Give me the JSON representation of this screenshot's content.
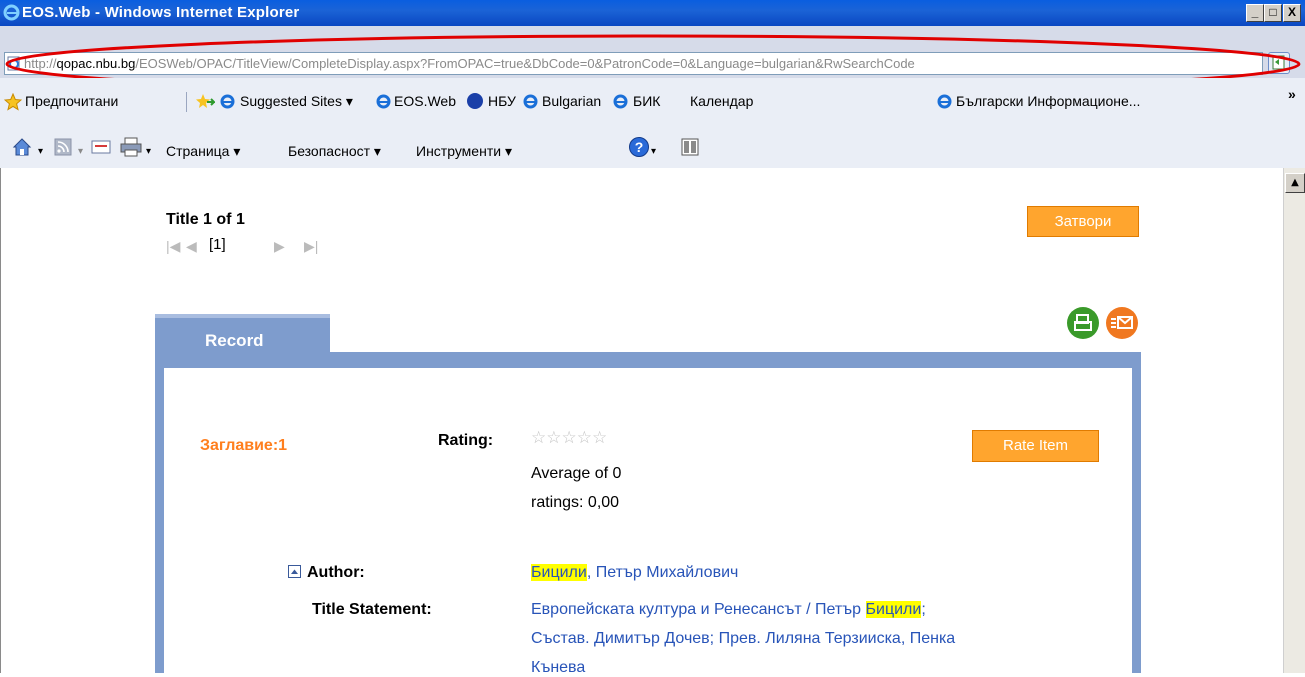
{
  "window": {
    "title": "EOS.Web - Windows Internet Explorer",
    "minimize": "_",
    "maximize": "□",
    "close": "X"
  },
  "address": {
    "url_prefix": "http://",
    "url_host": "qopac.nbu.bg",
    "url_rest": "/EOSWeb/OPAC/TitleView/CompleteDisplay.aspx?FromOPAC=true&DbCode=0&PatronCode=0&Language=bulgarian&RwSearchCode"
  },
  "favorites": {
    "favorites_label": "Предпочитани",
    "items": [
      "Suggested Sites ▾",
      "EOS.Web",
      "НБУ",
      "Bulgarian",
      "БИК",
      "Календар",
      "Български Информационе..."
    ],
    "overflow": "»"
  },
  "commandbar": {
    "page": "Страница ▾",
    "safety": "Безопасност ▾",
    "tools": "Инструменти ▾",
    "help": "▾"
  },
  "content": {
    "title_count": "Title 1 of 1",
    "pager": {
      "first": "|◀",
      "prev": "◀",
      "current": "[1]",
      "next": "▶",
      "last": "▶|"
    },
    "close_button": "Затвори",
    "tab_label": "Record",
    "record": {
      "zaglavie_label": "Заглавие:1",
      "rating_label": "Rating:",
      "stars": "☆☆☆☆☆",
      "average_line1": "Average of 0",
      "average_line2": "ratings: 0,00",
      "rate_button": "Rate Item",
      "author_label": "Author:",
      "author_highlight": "Бицили",
      "author_rest": ", Петър Михайлович",
      "title_statement_label": "Title Statement:",
      "title_line1_pre": "Европейската култура и Ренесансът / Петър ",
      "title_line1_hl": "Бицили",
      "title_line1_post": ";",
      "title_line2": "Състав. Димитър Дочев; Прев. Лиляна Терзииска, Пенка",
      "title_line3": "Кънева"
    }
  },
  "colors": {
    "accent_orange": "#ffa52e",
    "tab_blue": "#7e9ccd",
    "link_blue": "#2854b8",
    "highlight": "#ffff00",
    "annotation_red": "#e00000"
  }
}
